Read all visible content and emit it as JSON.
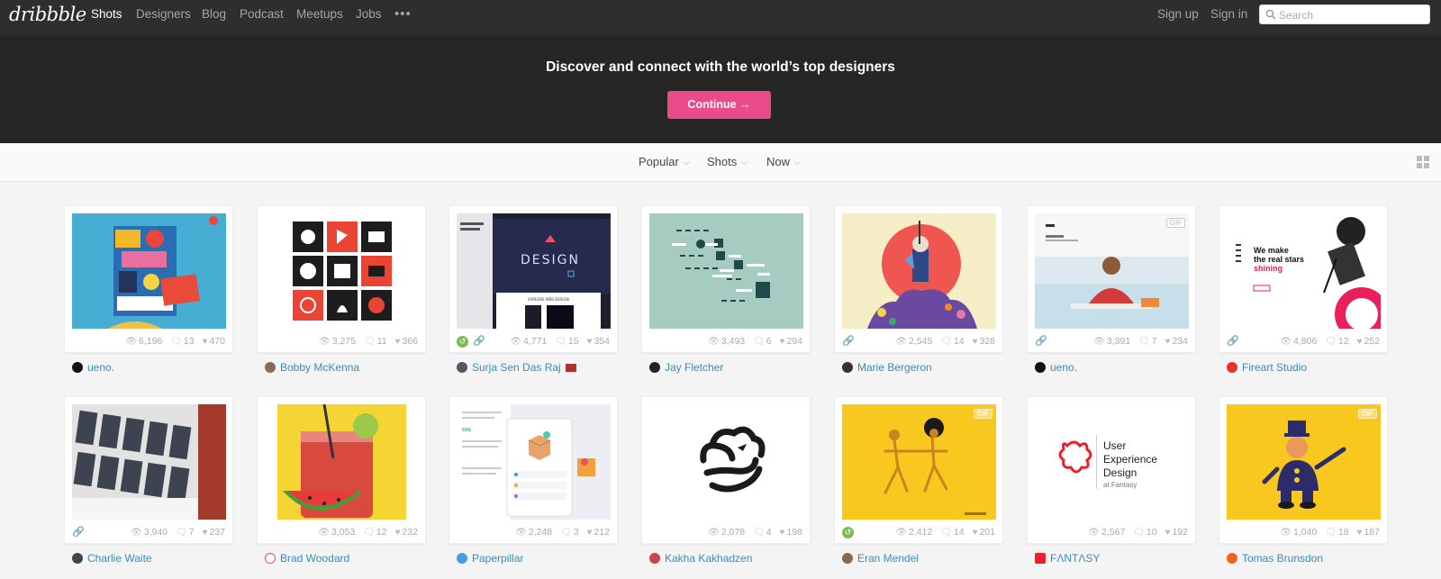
{
  "nav": {
    "logo": "dribbble",
    "links": [
      "Shots",
      "Designers",
      "Blog",
      "Podcast",
      "Meetups",
      "Jobs"
    ],
    "more": "•••",
    "sign_up": "Sign up",
    "sign_in": "Sign in",
    "search_placeholder": "Search"
  },
  "hero": {
    "title": "Discover and connect with the world’s top designers",
    "button": "Continue →"
  },
  "filters": {
    "sort": "Popular",
    "type": "Shots",
    "time": "Now"
  },
  "colors": {
    "brand_pink": "#ea4c89",
    "link_blue": "#3a8bbb",
    "nav_bg": "#2e2e2e",
    "hero_bg": "#262626"
  },
  "shots": [
    {
      "views": "6,196",
      "comments": "13",
      "likes": "470",
      "author": "ueno.",
      "attach": false,
      "rebound": false,
      "gif": false
    },
    {
      "views": "3,275",
      "comments": "11",
      "likes": "366",
      "author": "Bobby McKenna",
      "attach": false,
      "rebound": false,
      "gif": false
    },
    {
      "views": "4,771",
      "comments": "15",
      "likes": "354",
      "author": "Surja Sen Das Raj",
      "attach": true,
      "rebound": true,
      "gif": false
    },
    {
      "views": "3,493",
      "comments": "6",
      "likes": "294",
      "author": "Jay Fletcher",
      "attach": false,
      "rebound": false,
      "gif": false
    },
    {
      "views": "2,545",
      "comments": "14",
      "likes": "328",
      "author": "Marie Bergeron",
      "attach": true,
      "rebound": false,
      "gif": false
    },
    {
      "views": "3,391",
      "comments": "7",
      "likes": "234",
      "author": "ueno.",
      "attach": true,
      "rebound": false,
      "gif": true
    },
    {
      "views": "4,806",
      "comments": "12",
      "likes": "252",
      "author": "Fireart Studio",
      "attach": true,
      "rebound": false,
      "gif": false
    },
    {
      "views": "3,940",
      "comments": "7",
      "likes": "237",
      "author": "Charlie Waite",
      "attach": true,
      "rebound": false,
      "gif": false
    },
    {
      "views": "3,053",
      "comments": "12",
      "likes": "232",
      "author": "Brad Woodard",
      "attach": false,
      "rebound": false,
      "gif": false
    },
    {
      "views": "2,248",
      "comments": "3",
      "likes": "212",
      "author": "Paperpillar",
      "attach": false,
      "rebound": false,
      "gif": false
    },
    {
      "views": "2,078",
      "comments": "4",
      "likes": "198",
      "author": "Kakha Kakhadzen",
      "attach": false,
      "rebound": false,
      "gif": false
    },
    {
      "views": "2,412",
      "comments": "14",
      "likes": "201",
      "author": "Eran Mendel",
      "attach": false,
      "rebound": true,
      "gif": true
    },
    {
      "views": "2,567",
      "comments": "10",
      "likes": "192",
      "author": "FΛNTΛSY",
      "attach": false,
      "rebound": false,
      "gif": false
    },
    {
      "views": "1,040",
      "comments": "18",
      "likes": "187",
      "author": "Tomas Brunsdon",
      "attach": false,
      "rebound": false,
      "gif": true
    }
  ],
  "thumb_text": {
    "design": "DESIGN",
    "explore": "EXPLORE WEB DESIGN",
    "we_make": "We make",
    "real_stars": "the real stars",
    "shining": "shining",
    "ux1": "User",
    "ux2": "Experience",
    "ux3": "Design",
    "ux4": "at Fantasy",
    "gif": "GIF"
  }
}
